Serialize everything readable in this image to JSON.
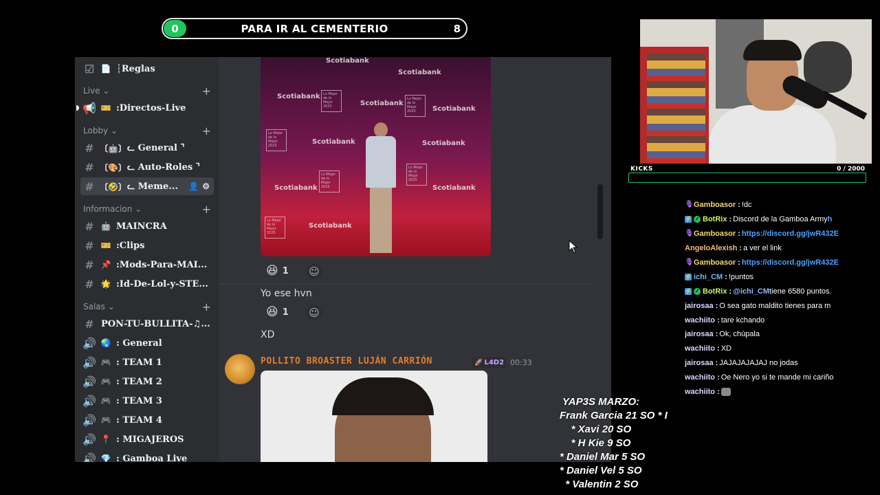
{
  "goal": {
    "count": "0",
    "title": "PARA IR AL CEMENTERIO",
    "target": "8"
  },
  "sidebar": {
    "rows": [
      {
        "kind": "channel",
        "icon": "☑",
        "emoji": "📄",
        "label": "┆Reglas"
      },
      {
        "kind": "category",
        "label": "Live ⌄",
        "plus": "+"
      },
      {
        "kind": "channel",
        "icon": "📢",
        "emoji": "🎫",
        "label": ":Directos-Live"
      },
      {
        "kind": "category",
        "label": "Lobby ⌄",
        "plus": "+"
      },
      {
        "kind": "channel",
        "icon": "#",
        "emoji": "〔🤖〕",
        "label": "ᓚ General ⌝"
      },
      {
        "kind": "channel",
        "icon": "#",
        "emoji": "〔🎨〕",
        "label": "ᓚ Auto-Roles ⌝"
      },
      {
        "kind": "channel",
        "icon": "#",
        "emoji": "〔🤣〕",
        "label": "ᓚ Meme..."
      },
      {
        "kind": "category",
        "label": "Informacion ⌄",
        "plus": "+"
      },
      {
        "kind": "channel",
        "icon": "#",
        "emoji": "🤖",
        "label": "MAINCRA"
      },
      {
        "kind": "channel",
        "icon": "#",
        "emoji": "🎫",
        "label": ":Clips"
      },
      {
        "kind": "channel",
        "icon": "#",
        "emoji": "📌",
        "label": ":Mods-Para-MAI..."
      },
      {
        "kind": "channel",
        "icon": "#",
        "emoji": "🌟",
        "label": ":Id-De-Lol-y-STE..."
      },
      {
        "kind": "category",
        "label": "Salas ⌄",
        "plus": "+"
      },
      {
        "kind": "channel",
        "icon": "#",
        "emoji": "",
        "label": "PON-TU-BULLITA-♫..."
      },
      {
        "kind": "channel",
        "icon": "🔊",
        "emoji": "🌏",
        "label": ": General"
      },
      {
        "kind": "channel",
        "icon": "🔊",
        "emoji": "🎮",
        "label": ": TEAM 1"
      },
      {
        "kind": "channel",
        "icon": "🔊",
        "emoji": "🎮",
        "label": ": TEAM 2"
      },
      {
        "kind": "channel",
        "icon": "🔊",
        "emoji": "🎮",
        "label": ": TEAM 3"
      },
      {
        "kind": "channel",
        "icon": "🔊",
        "emoji": "🎮",
        "label": ": TEAM 4"
      },
      {
        "kind": "channel",
        "icon": "🔊",
        "emoji": "📍",
        "label": ": MIGAJEROS"
      },
      {
        "kind": "channel",
        "icon": "🔊",
        "emoji": "💎",
        "label": ": Gamboa Live"
      }
    ],
    "active_actions": [
      "👤",
      "⚙"
    ]
  },
  "chat": {
    "image1_brand": "Scotiabank",
    "image1_wall_text": "Lo Mejor de lo Mejor 2025",
    "reaction1": {
      "emoji": "😆",
      "count": "1",
      "add": "☺"
    },
    "message1": "Yo ese hvn",
    "reaction2": {
      "emoji": "😆",
      "count": "1",
      "add": "☺"
    },
    "message2": "XD",
    "author": "POLLITO BROASTER LUJÁN CARRIÓN",
    "role_badge": "L4D2",
    "role_icon": "🚀",
    "timestamp": "00:33"
  },
  "webcam": {
    "kicks_label": "KICKS",
    "kicks_count": "0 / 2000",
    "kicks_progress": 0
  },
  "stream_chat": [
    {
      "badges": [
        "mic"
      ],
      "name": "Gamboasor",
      "name_color": "#f5d76e",
      "parts": [
        {
          "t": "!dc",
          "c": "msg"
        }
      ]
    },
    {
      "badges": [
        "bot",
        "ver"
      ],
      "name": "BotRix",
      "name_color": "#c7f26b",
      "parts": [
        {
          "t": "Discord de la Gamboa Army ",
          "c": "msg"
        },
        {
          "t": "h",
          "c": "link"
        }
      ]
    },
    {
      "badges": [
        "mic"
      ],
      "name": "Gamboasor",
      "name_color": "#f5d76e",
      "parts": [
        {
          "t": "https://discord.gg/jwR432E",
          "c": "link"
        }
      ]
    },
    {
      "badges": [],
      "name": "AngeloAlexish",
      "name_color": "#f5b97a",
      "parts": [
        {
          "t": "a ver el link",
          "c": "msg"
        }
      ]
    },
    {
      "badges": [
        "mic"
      ],
      "name": "Gamboasor",
      "name_color": "#f5d76e",
      "parts": [
        {
          "t": "https://discord.gg/jwR432E",
          "c": "link"
        }
      ]
    },
    {
      "badges": [
        "bot"
      ],
      "name": "ichi_CM",
      "name_color": "#6fb7ff",
      "parts": [
        {
          "t": "!puntos",
          "c": "msg"
        }
      ]
    },
    {
      "badges": [
        "bot",
        "ver"
      ],
      "name": "BotRix",
      "name_color": "#c7f26b",
      "parts": [
        {
          "t": "@ichi_CM",
          "c": "mention"
        },
        {
          "t": " tiene 6580 puntos.",
          "c": "msg"
        }
      ]
    },
    {
      "badges": [],
      "name": "jairosaa",
      "name_color": "#d8d8ff",
      "parts": [
        {
          "t": "O sea gato maldito tienes para m",
          "c": "msg"
        }
      ]
    },
    {
      "badges": [],
      "name": "wachiito",
      "name_color": "#d8d8ff",
      "parts": [
        {
          "t": "tare kchando",
          "c": "msg"
        }
      ]
    },
    {
      "badges": [],
      "name": "jairosaa",
      "name_color": "#d8d8ff",
      "parts": [
        {
          "t": "Ok, chúpala",
          "c": "msg"
        }
      ]
    },
    {
      "badges": [],
      "name": "wachiito",
      "name_color": "#d8d8ff",
      "parts": [
        {
          "t": "XD",
          "c": "msg"
        }
      ]
    },
    {
      "badges": [],
      "name": "jairosaa",
      "name_color": "#d8d8ff",
      "parts": [
        {
          "t": "JAJAJAJAJAJ no jodas",
          "c": "msg"
        }
      ]
    },
    {
      "badges": [],
      "name": "wachiito",
      "name_color": "#d8d8ff",
      "parts": [
        {
          "t": "Oe Nero yo si te mande mi cariño",
          "c": "msg"
        }
      ]
    },
    {
      "badges": [],
      "name": "wachiito",
      "name_color": "#d8d8ff",
      "parts": [
        {
          "t": "",
          "c": "emote"
        }
      ]
    }
  ],
  "yaps": [
    " YAP3S MARZO:",
    "Frank Garcia 21 SO * I",
    "    * Xavi 20 SO",
    "    * H Kie 9 SO",
    "* Daniel Mar 5 SO",
    "* Daniel Vel 5 SO",
    "  * Valentin 2 SO"
  ]
}
